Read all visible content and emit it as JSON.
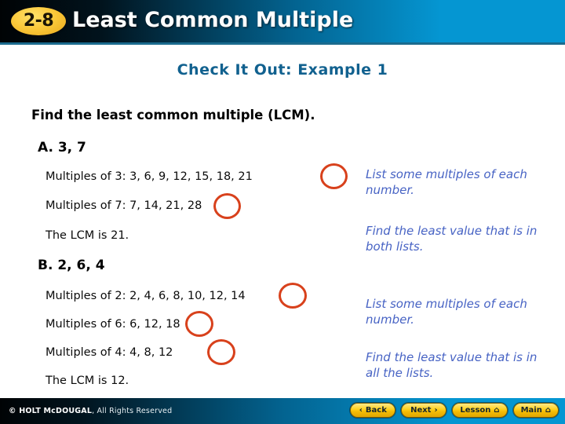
{
  "header": {
    "badge": "2-8",
    "title": "Least Common Multiple"
  },
  "slide": {
    "example_title": "Check It Out: Example 1",
    "prompt": "Find the least common multiple (LCM).",
    "parts": [
      {
        "label": "A. 3, 7",
        "lines": [
          "Multiples of 3: 3, 6, 9, 12, 15, 18, 21",
          "Multiples of 7: 7, 14, 21, 28"
        ],
        "result": "The LCM is 21.",
        "circled": "21"
      },
      {
        "label": "B. 2, 6, 4",
        "lines": [
          "Multiples of 2: 2, 4, 6, 8, 10, 12, 14",
          "Multiples of 6: 6, 12, 18",
          "Multiples of 4: 4, 8, 12"
        ],
        "result": "The LCM is 12.",
        "circled": "12"
      }
    ],
    "annotations": [
      "List some multiples of each number.",
      "Find the least value that is in both lists.",
      "List some multiples of each number.",
      "Find the least value that is in all the lists."
    ]
  },
  "footer": {
    "copyright_mark": "© HOLT McDOUGAL",
    "copyright_rest": ", All Rights Reserved",
    "nav": [
      {
        "label": "Back",
        "icon_left": "‹",
        "icon_right": ""
      },
      {
        "label": "Next",
        "icon_left": "",
        "icon_right": "›"
      },
      {
        "label": "Lesson",
        "icon_left": "",
        "icon_right": "⌂"
      },
      {
        "label": "Main",
        "icon_left": "",
        "icon_right": "⌂"
      }
    ]
  },
  "colors": {
    "header_blue": "#0596d2",
    "header_dark": "#000305",
    "badge_gold": "#fbc93b",
    "example_title_blue": "#11618f",
    "annotation_blue": "#4763c4",
    "circle_red": "#d8411c",
    "button_gold": "#ffd21f"
  }
}
